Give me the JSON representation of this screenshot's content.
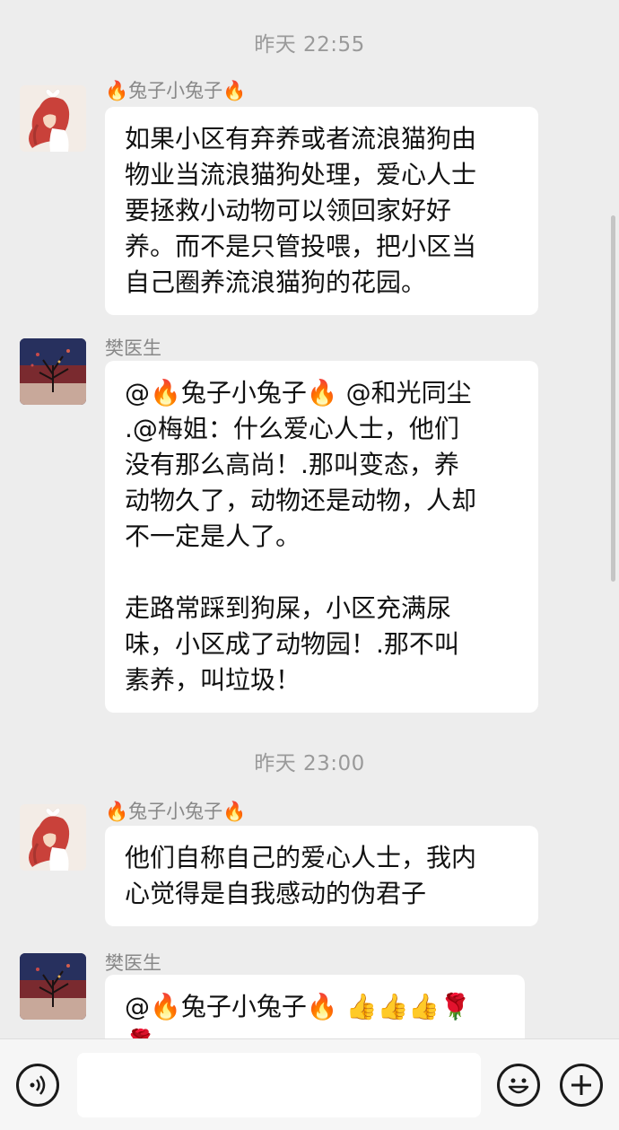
{
  "messages_area": {
    "timestamps": [
      "昨天 22:55",
      "昨天 23:00"
    ],
    "messages": [
      {
        "sender": "🔥兔子小兔子🔥",
        "text": "如果小区有弃养或者流浪猫狗由\n物业当流浪猫狗处理，爱心人士\n要拯救小动物可以领回家好好\n养。而不是只管投喂，把小区当\n自己圈养流浪猫狗的花园。"
      },
      {
        "sender": "樊医生",
        "text": "@🔥兔子小兔子🔥 @和光同尘\n.@梅姐：什么爱心人士，他们\n没有那么高尚！.那叫变态，养\n动物久了，动物还是动物，人却\n不一定是人了。\n\n走路常踩到狗屎，小区充满尿\n味，小区成了动物园！.那不叫\n素养，叫垃圾！"
      },
      {
        "sender": "🔥兔子小兔子🔥",
        "text": "他们自称自己的爱心人士，我内\n心觉得是自我感动的伪君子"
      },
      {
        "sender": "樊医生",
        "text": "@🔥兔子小兔子🔥 👍👍👍🌹\n🌹"
      }
    ]
  },
  "input_bar": {
    "voice_icon": "voice-icon",
    "emoji_icon": "emoji-icon",
    "plus_icon": "plus-icon"
  }
}
